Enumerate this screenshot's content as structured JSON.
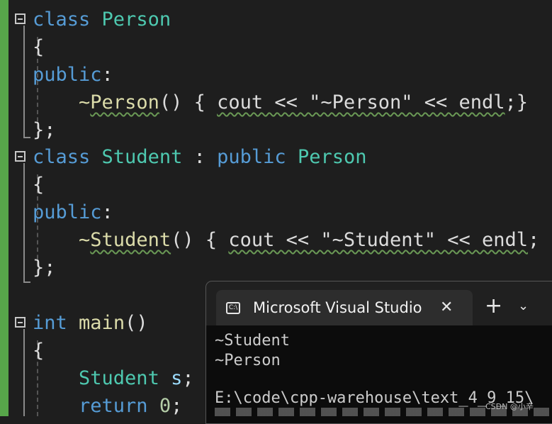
{
  "editor": {
    "lines": [
      {
        "id": "l1",
        "parts": [
          {
            "t": "class",
            "c": "kw"
          },
          {
            "t": " "
          },
          {
            "t": "Person",
            "c": "ty"
          }
        ]
      },
      {
        "id": "l2",
        "parts": [
          {
            "t": "{"
          }
        ]
      },
      {
        "id": "l3",
        "parts": [
          {
            "t": "public",
            "c": "kw"
          },
          {
            "t": ":"
          }
        ]
      },
      {
        "id": "l4",
        "parts": [
          {
            "t": "    "
          },
          {
            "t": "~",
            "c": "fn"
          },
          {
            "t": "Person",
            "c": "fn squig"
          },
          {
            "t": "() { "
          },
          {
            "t": "cout << \"~Person\" << endl",
            "c": "squig"
          },
          {
            "t": ";}"
          }
        ]
      },
      {
        "id": "l5",
        "parts": [
          {
            "t": "};"
          }
        ]
      },
      {
        "id": "l6",
        "parts": [
          {
            "t": "class",
            "c": "kw"
          },
          {
            "t": " "
          },
          {
            "t": "Student",
            "c": "ty"
          },
          {
            "t": " : "
          },
          {
            "t": "public",
            "c": "kw"
          },
          {
            "t": " "
          },
          {
            "t": "Person",
            "c": "ty"
          }
        ]
      },
      {
        "id": "l7",
        "parts": [
          {
            "t": "{"
          }
        ]
      },
      {
        "id": "l8",
        "parts": [
          {
            "t": "public",
            "c": "kw"
          },
          {
            "t": ":"
          }
        ]
      },
      {
        "id": "l9",
        "parts": [
          {
            "t": "    "
          },
          {
            "t": "~",
            "c": "fn"
          },
          {
            "t": "Student",
            "c": "fn squig"
          },
          {
            "t": "() { "
          },
          {
            "t": "cout << \"~Student\" << endl",
            "c": "squig"
          },
          {
            "t": "; }"
          }
        ]
      },
      {
        "id": "l10",
        "parts": [
          {
            "t": "};"
          }
        ]
      },
      {
        "id": "l11",
        "parts": [
          {
            "t": ""
          }
        ]
      },
      {
        "id": "l12",
        "parts": [
          {
            "t": "int",
            "c": "kw"
          },
          {
            "t": " "
          },
          {
            "t": "main",
            "c": "fn"
          },
          {
            "t": "()"
          }
        ]
      },
      {
        "id": "l13",
        "parts": [
          {
            "t": "{"
          }
        ]
      },
      {
        "id": "l14",
        "parts": [
          {
            "t": "    "
          },
          {
            "t": "Student",
            "c": "ty"
          },
          {
            "t": " "
          },
          {
            "t": "s",
            "c": "var"
          },
          {
            "t": ";"
          }
        ]
      },
      {
        "id": "l15",
        "parts": [
          {
            "t": "    "
          },
          {
            "t": "return",
            "c": "kw"
          },
          {
            "t": " "
          },
          {
            "t": "0",
            "c": "num"
          },
          {
            "t": ";"
          }
        ]
      }
    ]
  },
  "terminal": {
    "tab_icon": "C:\\",
    "tab_title": "Microsoft Visual Studio",
    "close_glyph": "✕",
    "new_tab_glyph": "+",
    "dropdown_glyph": "⌄",
    "output": [
      "~Student",
      "~Person",
      "",
      "E:\\code\\cpp-warehouse\\text_4_9_15\\"
    ]
  },
  "watermark": "CSDN @小辛",
  "icons": {
    "fold_toggle": "collapse-box-icon",
    "console": "console-icon",
    "close": "close-icon",
    "plus": "plus-icon",
    "dropdown": "chevron-down-icon"
  },
  "colors": {
    "background": "#1e1e1e",
    "keyword": "#569cd6",
    "type": "#4ec9b0",
    "function": "#dcdcaa",
    "string": "#d69d85",
    "squiggle": "#6a9955",
    "change_bar": "#57a64a"
  }
}
